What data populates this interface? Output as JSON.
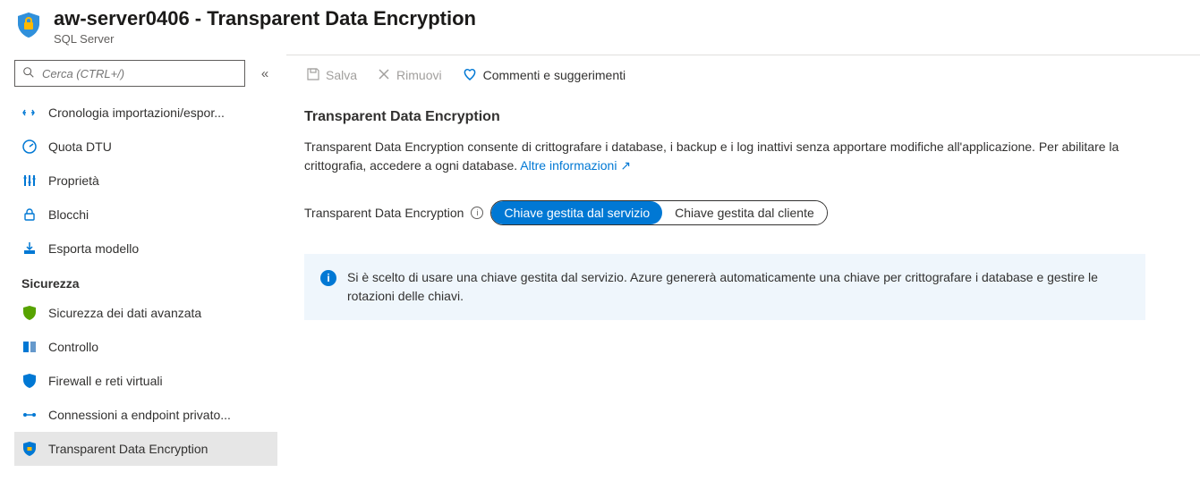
{
  "header": {
    "title": "aw-server0406 - Transparent Data Encryption",
    "subtitle": "SQL Server"
  },
  "search": {
    "placeholder": "Cerca (CTRL+/)"
  },
  "sidebar": {
    "top_items": [
      {
        "label": "Cronologia importazioni/espor...",
        "icon": "history"
      },
      {
        "label": "Quota DTU",
        "icon": "gauge"
      },
      {
        "label": "Proprietà",
        "icon": "properties"
      },
      {
        "label": "Blocchi",
        "icon": "lock"
      },
      {
        "label": "Esporta modello",
        "icon": "export"
      }
    ],
    "section_label": "Sicurezza",
    "security_items": [
      {
        "label": "Sicurezza dei dati avanzata",
        "icon": "shield-green"
      },
      {
        "label": "Controllo",
        "icon": "audit"
      },
      {
        "label": "Firewall e reti virtuali",
        "icon": "firewall"
      },
      {
        "label": "Connessioni a endpoint privato...",
        "icon": "endpoint"
      },
      {
        "label": "Transparent Data Encryption",
        "icon": "shield-blue",
        "selected": true
      }
    ]
  },
  "toolbar": {
    "save": "Salva",
    "remove": "Rimuovi",
    "feedback": "Commenti e suggerimenti"
  },
  "main": {
    "heading": "Transparent Data Encryption",
    "description": "Transparent Data Encryption consente di crittografare i database, i backup e i log inattivi senza apportare modifiche all'applicazione. Per abilitare la crittografia, accedere a ogni database.",
    "learn_more": "Altre informazioni",
    "setting_label": "Transparent Data Encryption",
    "toggle": {
      "option_a": "Chiave gestita dal servizio",
      "option_b": "Chiave gestita dal cliente"
    },
    "banner": "Si è scelto di usare una chiave gestita dal servizio. Azure genererà automaticamente una chiave per crittografare i database e gestire le rotazioni delle chiavi."
  }
}
